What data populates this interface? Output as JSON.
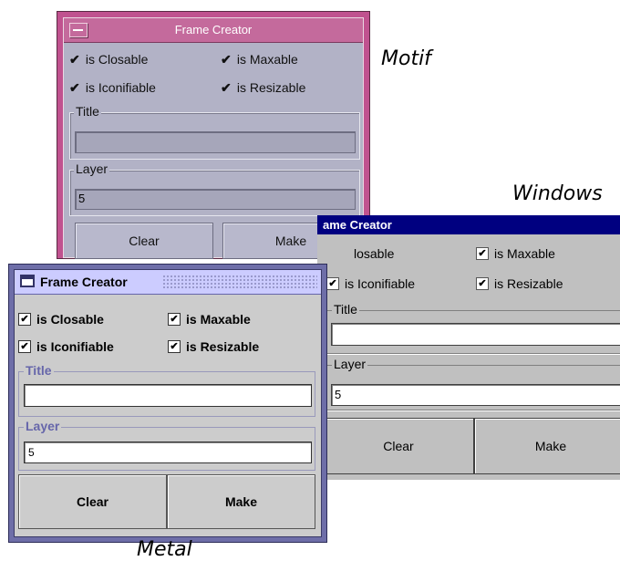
{
  "captions": {
    "motif": "Motif",
    "windows": "Windows",
    "metal": "Metal"
  },
  "colors": {
    "motif_frame": "#c0528f",
    "motif_bg": "#b2b2c6",
    "windows_title_bg": "#000080",
    "windows_bg": "#c0c0c0",
    "metal_frame": "#6e6ea8",
    "metal_title_bg": "#ccccff",
    "metal_bg": "#cccccc"
  },
  "motif": {
    "title": "Frame Creator",
    "menu_icon": "window-menu-icon",
    "check_icon": "checkmark-icon",
    "checkboxes": {
      "closable": "is Closable",
      "maxable": "is Maxable",
      "iconifiable": "is Iconifiable",
      "resizable": "is Resizable"
    },
    "title_label": "Title",
    "title_value": "",
    "layer_label": "Layer",
    "layer_value": "5",
    "clear_label": "Clear",
    "make_label": "Make"
  },
  "windows": {
    "title": "ame Creator",
    "check_icon": "checkmark-icon",
    "checkboxes": {
      "closable": "losable",
      "maxable": "is Maxable",
      "iconifiable": "is Iconifiable",
      "resizable": "is Resizable"
    },
    "title_label": "Title",
    "title_value": "",
    "layer_label": "Layer",
    "layer_value": "5",
    "clear_label": "Clear",
    "make_label": "Make"
  },
  "metal": {
    "title": "Frame Creator",
    "frame_icon": "frame-icon",
    "check_icon": "checkmark-icon",
    "checkboxes": {
      "closable": "is Closable",
      "maxable": "is Maxable",
      "iconifiable": "is Iconifiable",
      "resizable": "is Resizable"
    },
    "title_label": "Title",
    "title_value": "",
    "layer_label": "Layer",
    "layer_value": "5",
    "clear_label": "Clear",
    "make_label": "Make"
  }
}
